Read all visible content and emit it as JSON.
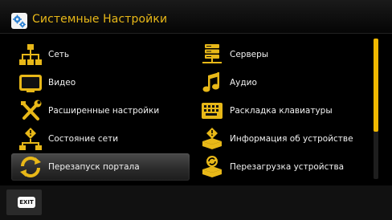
{
  "header": {
    "title": "Системные Настройки",
    "icon": "settings-gears-icon"
  },
  "left_column": [
    {
      "label": "Сеть",
      "icon": "network-icon"
    },
    {
      "label": "Видео",
      "icon": "tv-icon"
    },
    {
      "label": "Расширенные настройки",
      "icon": "tools-icon"
    },
    {
      "label": "Состояние сети",
      "icon": "network-status-icon"
    },
    {
      "label": "Перезапуск портала",
      "icon": "refresh-icon",
      "selected": true
    }
  ],
  "right_column": [
    {
      "label": "Серверы",
      "icon": "servers-icon"
    },
    {
      "label": "Аудио",
      "icon": "music-note-icon"
    },
    {
      "label": "Раскладка клавиатуры",
      "icon": "keyboard-icon"
    },
    {
      "label": "Информация об устройстве",
      "icon": "device-info-icon"
    },
    {
      "label": "Перезагрузка устройства",
      "icon": "device-reboot-icon"
    }
  ],
  "footer": {
    "exit_label": "EXIT"
  },
  "colors": {
    "accent": "#e8b818",
    "background": "#000000",
    "selected_bg": "#3a3a3a"
  },
  "scroll": {
    "visible_fraction": 0.66
  }
}
